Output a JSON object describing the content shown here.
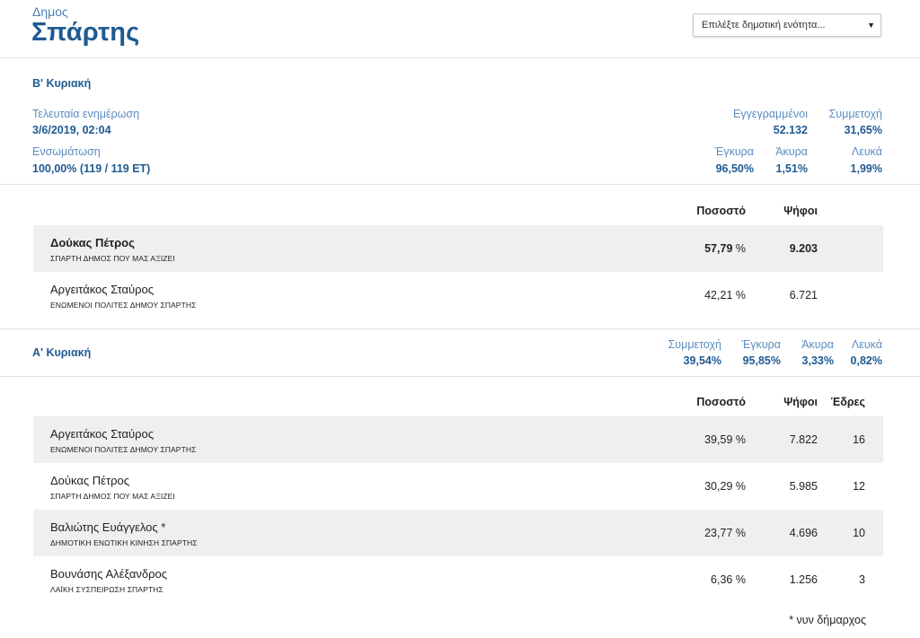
{
  "header": {
    "label": "Δημος",
    "name": "Σπάρτης",
    "select_text": "Επιλέξτε δημοτική ενότητα...",
    "select_arrow": "▼"
  },
  "round2": {
    "title": "Β' Κυριακή",
    "last_update_label": "Τελευταία ενημέρωση",
    "last_update_value": "3/6/2019, 02:04",
    "integration_label": "Ενσωμάτωση",
    "integration_value": "100,00% (119 / 119 ΕΤ)",
    "registered_label": "Εγγεγραμμένοι",
    "registered_value": "52.132",
    "turnout_label": "Συμμετοχή",
    "turnout_value": "31,65%",
    "valid_label": "Έγκυρα",
    "valid_value": "96,50%",
    "invalid_label": "Άκυρα",
    "invalid_value": "1,51%",
    "blank_label": "Λευκά",
    "blank_value": "1,99%",
    "headers": {
      "percent": "Ποσοστό",
      "votes": "Ψήφοι"
    },
    "rows": [
      {
        "name": "Δούκας Πέτρος",
        "party": "ΣΠΑΡΤΗ ΔΗΜΟΣ ΠΟΥ ΜΑΣ ΑΞΙΖΕΙ",
        "percent": "57,79",
        "votes": "9.203"
      },
      {
        "name": "Αργειτάκος Σταύρος",
        "party": "ΕΝΩΜΕΝΟΙ ΠΟΛΙΤΕΣ ΔΗΜΟΥ ΣΠΑΡΤΗΣ",
        "percent": "42,21",
        "votes": "6.721"
      }
    ]
  },
  "round1": {
    "title": "Α' Κυριακή",
    "turnout_label": "Συμμετοχή",
    "turnout_value": "39,54%",
    "valid_label": "Έγκυρα",
    "valid_value": "95,85%",
    "invalid_label": "Άκυρα",
    "invalid_value": "3,33%",
    "blank_label": "Λευκά",
    "blank_value": "0,82%",
    "headers": {
      "percent": "Ποσοστό",
      "votes": "Ψήφοι",
      "seats": "Έδρες"
    },
    "rows": [
      {
        "name": "Αργειτάκος Σταύρος",
        "party": "ΕΝΩΜΕΝΟΙ ΠΟΛΙΤΕΣ ΔΗΜΟΥ ΣΠΑΡΤΗΣ",
        "percent": "39,59",
        "votes": "7.822",
        "seats": "16"
      },
      {
        "name": "Δούκας Πέτρος",
        "party": "ΣΠΑΡΤΗ ΔΗΜΟΣ ΠΟΥ ΜΑΣ ΑΞΙΖΕΙ",
        "percent": "30,29",
        "votes": "5.985",
        "seats": "12"
      },
      {
        "name": "Βαλιώτης Ευάγγελος *",
        "party": "ΔΗΜΟΤΙΚΗ ΕΝΩΤΙΚΗ ΚΙΝΗΣΗ ΣΠΑΡΤΗΣ",
        "percent": "23,77",
        "votes": "4.696",
        "seats": "10"
      },
      {
        "name": "Βουνάσης Αλέξανδρος",
        "party": "ΛΑΪΚΗ ΣΥΣΠΕΙΡΩΣΗ ΣΠΑΡΤΗΣ",
        "percent": "6,36",
        "votes": "1.256",
        "seats": "3"
      }
    ]
  },
  "percent_sign": "%",
  "footnote": "* νυν δήμαρχος"
}
